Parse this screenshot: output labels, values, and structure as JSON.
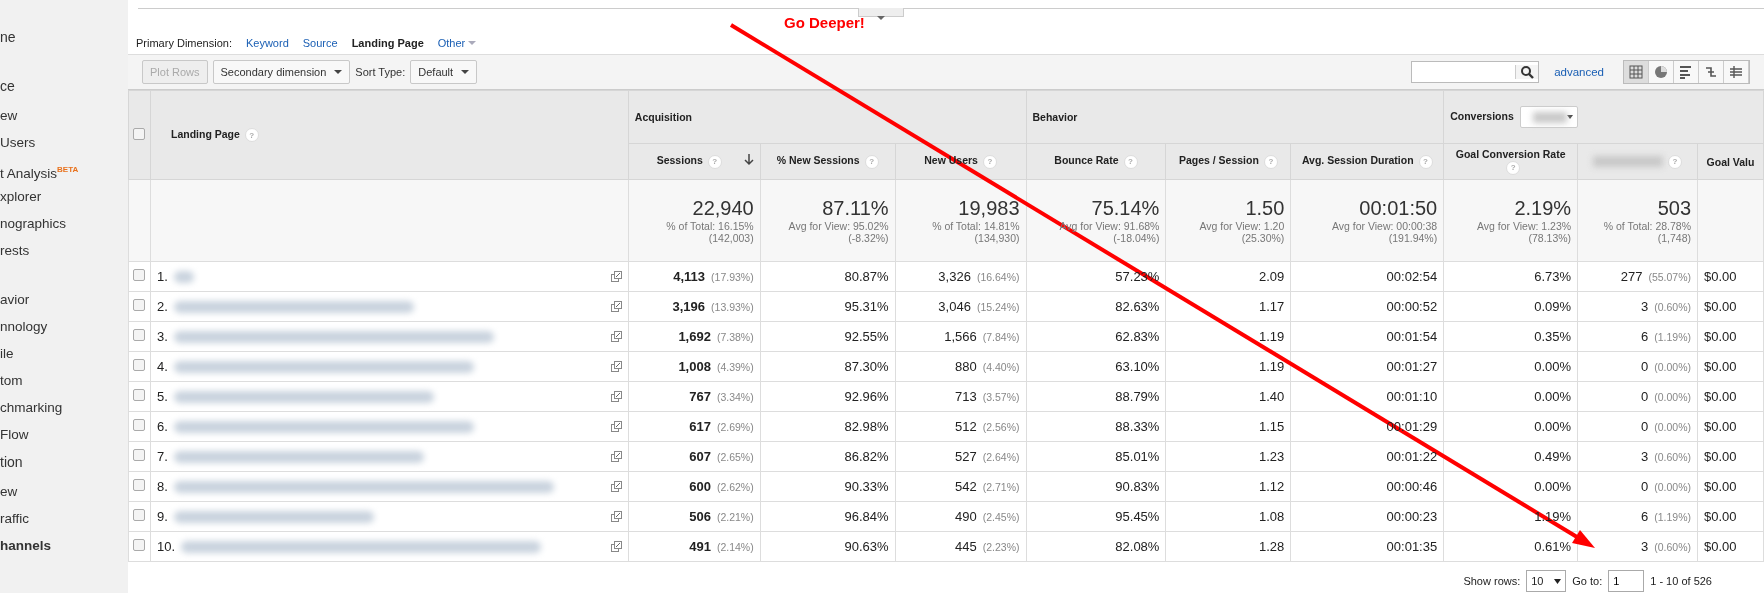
{
  "sidebar": {
    "items": [
      {
        "label": "ne",
        "kind": "section",
        "selected": false
      },
      {
        "label": "ce",
        "kind": "section",
        "selected": false
      },
      {
        "label": "ew",
        "kind": "item",
        "selected": false
      },
      {
        "label": "Users",
        "kind": "item",
        "selected": false
      },
      {
        "label": "t Analysis",
        "kind": "item",
        "selected": false,
        "badge": "BETA"
      },
      {
        "label": "xplorer",
        "kind": "item",
        "selected": false
      },
      {
        "label": "nographics",
        "kind": "item",
        "selected": false
      },
      {
        "label": "rests",
        "kind": "item",
        "selected": false
      },
      {
        "label": "avior",
        "kind": "gap-item",
        "selected": false
      },
      {
        "label": "nnology",
        "kind": "item",
        "selected": false
      },
      {
        "label": "ile",
        "kind": "item",
        "selected": false
      },
      {
        "label": "tom",
        "kind": "item",
        "selected": false
      },
      {
        "label": "chmarking",
        "kind": "item",
        "selected": false
      },
      {
        "label": "Flow",
        "kind": "item",
        "selected": false
      },
      {
        "label": "tion",
        "kind": "section",
        "selected": false
      },
      {
        "label": "ew",
        "kind": "item",
        "selected": false
      },
      {
        "label": "raffic",
        "kind": "item",
        "selected": false
      },
      {
        "label": "hannels",
        "kind": "item",
        "selected": true
      }
    ]
  },
  "annotation": {
    "text": "Go Deeper!"
  },
  "primary_dimension": {
    "label": "Primary Dimension:",
    "options": [
      {
        "label": "Keyword",
        "kind": "link",
        "selected": false
      },
      {
        "label": "Source",
        "kind": "link",
        "selected": false
      },
      {
        "label": "Landing Page",
        "kind": "link",
        "selected": true
      },
      {
        "label": "Other",
        "kind": "menu",
        "selected": false
      }
    ]
  },
  "toolbar": {
    "plot_rows": {
      "label": "Plot Rows",
      "disabled": true
    },
    "secondary_dimension": "Secondary dimension",
    "sort_type_label": "Sort Type:",
    "sort_type": "Default",
    "advanced": "advanced",
    "views": [
      {
        "kind": "table",
        "selected": true
      },
      {
        "kind": "pie",
        "selected": false
      },
      {
        "kind": "performance",
        "selected": false
      },
      {
        "kind": "comparison",
        "selected": false
      },
      {
        "kind": "pivot",
        "selected": false
      }
    ]
  },
  "table": {
    "select_all": {
      "checked": false
    },
    "dimension": {
      "label": "Landing Page",
      "help": "?"
    },
    "groups": [
      {
        "label": "Acquisition",
        "selector": false,
        "columns": [
          {
            "label": "Sessions",
            "help": "?",
            "sorted": true
          },
          {
            "label": "% New Sessions",
            "help": "?",
            "sorted": false
          },
          {
            "label": "New Users",
            "help": "?",
            "sorted": false
          }
        ]
      },
      {
        "label": "Behavior",
        "selector": false,
        "columns": [
          {
            "label": "Bounce Rate",
            "help": "?",
            "sorted": false
          },
          {
            "label": "Pages / Session",
            "help": "?",
            "sorted": false
          },
          {
            "label": "Avg. Session Duration",
            "help": "?",
            "sorted": false
          }
        ]
      },
      {
        "label": "Conversions",
        "selector": true,
        "columns": [
          {
            "label": "Goal Conversion Rate",
            "help": "?",
            "sorted": false
          },
          {
            "kind": "blurred",
            "help": "?",
            "sorted": false
          },
          {
            "label": "Goal Valu",
            "sorted": false
          }
        ]
      }
    ],
    "totals": [
      {
        "value": "22,940",
        "line1": "% of Total: 16.15%",
        "line2": "(142,003)"
      },
      {
        "value": "87.11%",
        "line1": "Avg for View: 95.02%",
        "line2": "(-8.32%)"
      },
      {
        "value": "19,983",
        "line1": "% of Total: 14.81%",
        "line2": "(134,930)"
      },
      {
        "value": "75.14%",
        "line1": "Avg for View: 91.68%",
        "line2": "(-18.04%)"
      },
      {
        "value": "1.50",
        "line1": "Avg for View: 1.20",
        "line2": "(25.30%)"
      },
      {
        "value": "00:01:50",
        "line1": "Avg for View: 00:00:38",
        "line2": "(191.94%)"
      },
      {
        "value": "2.19%",
        "line1": "Avg for View: 1.23%",
        "line2": "(78.13%)"
      },
      {
        "value": "503",
        "line1": "% of Total: 28.78%",
        "line2": "(1,748)"
      }
    ],
    "rows": [
      {
        "index": "1.",
        "checked": false,
        "cells": [
          {
            "value": "4,113",
            "share": "(17.93%)"
          },
          {
            "value": "80.87%"
          },
          {
            "value": "3,326",
            "share": "(16.64%)"
          },
          {
            "value": "57.23%"
          },
          {
            "value": "2.09"
          },
          {
            "value": "00:02:54"
          },
          {
            "value": "6.73%"
          },
          {
            "value": "277",
            "share": "(55.07%)"
          },
          {
            "value": "$0.00"
          }
        ]
      },
      {
        "index": "2.",
        "checked": false,
        "cells": [
          {
            "value": "3,196",
            "share": "(13.93%)"
          },
          {
            "value": "95.31%"
          },
          {
            "value": "3,046",
            "share": "(15.24%)"
          },
          {
            "value": "82.63%"
          },
          {
            "value": "1.17"
          },
          {
            "value": "00:00:52"
          },
          {
            "value": "0.09%"
          },
          {
            "value": "3",
            "share": "(0.60%)"
          },
          {
            "value": "$0.00"
          }
        ]
      },
      {
        "index": "3.",
        "checked": false,
        "cells": [
          {
            "value": "1,692",
            "share": "(7.38%)"
          },
          {
            "value": "92.55%"
          },
          {
            "value": "1,566",
            "share": "(7.84%)"
          },
          {
            "value": "62.83%"
          },
          {
            "value": "1.19"
          },
          {
            "value": "00:01:54"
          },
          {
            "value": "0.35%"
          },
          {
            "value": "6",
            "share": "(1.19%)"
          },
          {
            "value": "$0.00"
          }
        ]
      },
      {
        "index": "4.",
        "checked": false,
        "cells": [
          {
            "value": "1,008",
            "share": "(4.39%)"
          },
          {
            "value": "87.30%"
          },
          {
            "value": "880",
            "share": "(4.40%)"
          },
          {
            "value": "63.10%"
          },
          {
            "value": "1.19"
          },
          {
            "value": "00:01:27"
          },
          {
            "value": "0.00%"
          },
          {
            "value": "0",
            "share": "(0.00%)"
          },
          {
            "value": "$0.00"
          }
        ]
      },
      {
        "index": "5.",
        "checked": false,
        "cells": [
          {
            "value": "767",
            "share": "(3.34%)"
          },
          {
            "value": "92.96%"
          },
          {
            "value": "713",
            "share": "(3.57%)"
          },
          {
            "value": "88.79%"
          },
          {
            "value": "1.40"
          },
          {
            "value": "00:01:10"
          },
          {
            "value": "0.00%"
          },
          {
            "value": "0",
            "share": "(0.00%)"
          },
          {
            "value": "$0.00"
          }
        ]
      },
      {
        "index": "6.",
        "checked": false,
        "cells": [
          {
            "value": "617",
            "share": "(2.69%)"
          },
          {
            "value": "82.98%"
          },
          {
            "value": "512",
            "share": "(2.56%)"
          },
          {
            "value": "88.33%"
          },
          {
            "value": "1.15"
          },
          {
            "value": "00:01:29"
          },
          {
            "value": "0.00%"
          },
          {
            "value": "0",
            "share": "(0.00%)"
          },
          {
            "value": "$0.00"
          }
        ]
      },
      {
        "index": "7.",
        "checked": false,
        "cells": [
          {
            "value": "607",
            "share": "(2.65%)"
          },
          {
            "value": "86.82%"
          },
          {
            "value": "527",
            "share": "(2.64%)"
          },
          {
            "value": "85.01%"
          },
          {
            "value": "1.23"
          },
          {
            "value": "00:01:22"
          },
          {
            "value": "0.49%"
          },
          {
            "value": "3",
            "share": "(0.60%)"
          },
          {
            "value": "$0.00"
          }
        ]
      },
      {
        "index": "8.",
        "checked": false,
        "cells": [
          {
            "value": "600",
            "share": "(2.62%)"
          },
          {
            "value": "90.33%"
          },
          {
            "value": "542",
            "share": "(2.71%)"
          },
          {
            "value": "90.83%"
          },
          {
            "value": "1.12"
          },
          {
            "value": "00:00:46"
          },
          {
            "value": "0.00%"
          },
          {
            "value": "0",
            "share": "(0.00%)"
          },
          {
            "value": "$0.00"
          }
        ]
      },
      {
        "index": "9.",
        "checked": false,
        "cells": [
          {
            "value": "506",
            "share": "(2.21%)"
          },
          {
            "value": "96.84%"
          },
          {
            "value": "490",
            "share": "(2.45%)"
          },
          {
            "value": "95.45%"
          },
          {
            "value": "1.08"
          },
          {
            "value": "00:00:23"
          },
          {
            "value": "1.19%"
          },
          {
            "value": "6",
            "share": "(1.19%)"
          },
          {
            "value": "$0.00"
          }
        ]
      },
      {
        "index": "10.",
        "checked": false,
        "cells": [
          {
            "value": "491",
            "share": "(2.14%)"
          },
          {
            "value": "90.63%"
          },
          {
            "value": "445",
            "share": "(2.23%)"
          },
          {
            "value": "82.08%"
          },
          {
            "value": "1.28"
          },
          {
            "value": "00:01:35"
          },
          {
            "value": "0.61%"
          },
          {
            "value": "3",
            "share": "(0.60%)"
          },
          {
            "value": "$0.00"
          }
        ]
      }
    ]
  },
  "footer": {
    "show_rows_label": "Show rows:",
    "show_rows": "10",
    "goto_label": "Go to:",
    "goto": "1",
    "range": "1 - 10 of 526"
  }
}
